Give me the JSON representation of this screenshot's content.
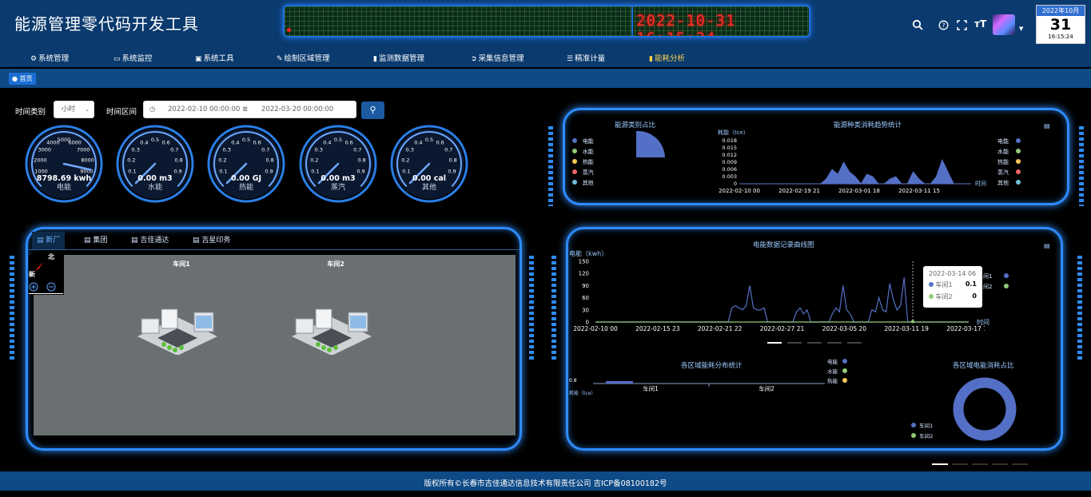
{
  "header": {
    "app_title": "能源管理零代码开发工具",
    "datetime": "2022-10-31 16:15:24",
    "calendar": {
      "month": "2022年10月",
      "day": "31",
      "time": "16:15:24"
    },
    "icons": [
      "search-icon",
      "help-icon",
      "fullscreen-icon",
      "font-size-icon",
      "avatar",
      "chevron-down-icon"
    ]
  },
  "menu": [
    {
      "label": "系统管理",
      "icon": "gear-icon"
    },
    {
      "label": "系统监控",
      "icon": "monitor-icon"
    },
    {
      "label": "系统工具",
      "icon": "toolbox-icon"
    },
    {
      "label": "绘制区域管理",
      "icon": "edit-icon"
    },
    {
      "label": "监测数据管理",
      "icon": "bar-chart-icon"
    },
    {
      "label": "采集信息管理",
      "icon": "send-icon"
    },
    {
      "label": "精准计量",
      "icon": "sliders-icon"
    },
    {
      "label": "能耗分析",
      "icon": "bar-chart-icon",
      "active": true,
      "active_color": "#ffd24a"
    }
  ],
  "breadcrumb": {
    "home": "首页"
  },
  "filters": {
    "time_type_label": "时间类别",
    "time_type_value": "小时",
    "time_range_label": "时间区间",
    "start": "2022-02-10 00:00:00",
    "end": "2022-03-20 00:00:00"
  },
  "gauges": [
    {
      "name": "电能",
      "value": "8798.69 kwh",
      "reading": 8798.69,
      "max": 10000,
      "ticks": [
        "1000",
        "2000",
        "3000",
        "4000",
        "5000",
        "6000",
        "7000",
        "8000",
        "9000"
      ],
      "unit_label": "kwh"
    },
    {
      "name": "水能",
      "value": "0.00 m3",
      "reading": 0,
      "max": 1,
      "ticks": [
        "0.1",
        "0.2",
        "0.3",
        "0.4",
        "0.5",
        "0.6",
        "0.7",
        "0.8",
        "0.9"
      ]
    },
    {
      "name": "热能",
      "value": "0.00 GJ",
      "reading": 0,
      "max": 1,
      "ticks": [
        "0.1",
        "0.2",
        "0.3",
        "0.4",
        "0.5",
        "0.6",
        "0.7",
        "0.8",
        "0.9"
      ]
    },
    {
      "name": "蒸汽",
      "value": "0.00 m3",
      "reading": 0,
      "max": 1,
      "ticks": [
        "0.1",
        "0.2",
        "0.3",
        "0.4",
        "0.5",
        "0.6",
        "0.7",
        "0.8",
        "0.9"
      ]
    },
    {
      "name": "其他",
      "value": "0.00 cal",
      "reading": 0,
      "max": 1,
      "ticks": [
        "0.1",
        "0.2",
        "0.3",
        "0.4",
        "0.5",
        "0.6",
        "0.7",
        "0.8",
        "0.9"
      ]
    }
  ],
  "energy_panel": {
    "pie_title": "能源类别占比",
    "trend_title": "能源种类消耗趋势统计",
    "y_label": "耗能（tce）",
    "x_label": "时间",
    "legend": [
      {
        "name": "电能",
        "color": "#5470c6"
      },
      {
        "name": "水能",
        "color": "#91cc75"
      },
      {
        "name": "热能",
        "color": "#fac858"
      },
      {
        "name": "蒸汽",
        "color": "#ee6666"
      },
      {
        "name": "其他",
        "color": "#73c0de"
      }
    ],
    "y_ticks": [
      "0",
      "0.003",
      "0.006",
      "0.009",
      "0.012",
      "0.015",
      "0.018"
    ],
    "x_ticks": [
      "2022-02-10 00",
      "2022-02-19 21",
      "2022-03-01 18",
      "2022-03-11 15"
    ]
  },
  "map_panel": {
    "tabs": [
      "新厂",
      "集团",
      "吉佳通达",
      "吉星印务"
    ],
    "north_label": "北",
    "side_label": "新",
    "workshops": [
      "车间1",
      "车间2"
    ]
  },
  "electric_panel": {
    "title": "电能数据记录曲线图",
    "y_label": "电能（kwh）",
    "x_label": "时间",
    "y_ticks": [
      "0",
      "30",
      "60",
      "90",
      "120",
      "150"
    ],
    "x_ticks": [
      "2022-02-10 00",
      "2022-02-15 23",
      "2022-02-21 22",
      "2022-02-27 21",
      "2022-03-05 20",
      "2022-03-11 19",
      "2022-03-17 18"
    ],
    "tooltip": {
      "time": "2022-03-14 06",
      "rows": [
        {
          "name": "车间1",
          "value": "0.1",
          "color": "#5470c6"
        },
        {
          "name": "车间2",
          "value": "0",
          "color": "#91cc75"
        }
      ]
    },
    "legend_partial": [
      "间1",
      "间2"
    ]
  },
  "region_panel": {
    "dist_title": "各区域能耗分布统计",
    "dist_y_label": "耗能（tce）",
    "dist_ticks": [
      "0.8",
      "0.6",
      "0.4",
      "0.2",
      "0"
    ],
    "dist_categories": [
      "车间1",
      "车间2"
    ],
    "dist_legend": [
      {
        "name": "电能",
        "color": "#5470c6"
      },
      {
        "name": "水能",
        "color": "#91cc75"
      },
      {
        "name": "热能",
        "color": "#fac858"
      }
    ],
    "share_title": "各区域电能消耗占比",
    "share_legend": [
      {
        "name": "车间1",
        "color": "#5470c6"
      },
      {
        "name": "车间2",
        "color": "#91cc75"
      }
    ]
  },
  "footer": {
    "text": "版权所有©长春市吉佳通达信息技术有限责任公司 吉ICP备08100182号"
  },
  "chart_data": [
    {
      "type": "pie",
      "title": "能源类别占比",
      "categories": [
        "电能",
        "水能",
        "热能",
        "蒸汽",
        "其他"
      ],
      "values": [
        100,
        0,
        0,
        0,
        0
      ]
    },
    {
      "type": "area",
      "title": "能源种类消耗趋势统计",
      "ylabel": "耗能（tce）",
      "xlabel": "时间",
      "ylim": [
        0,
        0.018
      ],
      "x_range": [
        "2022-02-10 00",
        "2022-03-20 00"
      ],
      "series": [
        {
          "name": "电能",
          "values": [
            0,
            0,
            0,
            0,
            0,
            0,
            0,
            0,
            0,
            0,
            0,
            0,
            0,
            0,
            0,
            0.002,
            0.006,
            0.004,
            0.009,
            0.005,
            0.003,
            0,
            0.004,
            0.003,
            0,
            0,
            0.002,
            0.003,
            0,
            0,
            0.005,
            0.002,
            0,
            0,
            0.003,
            0.01,
            0.005,
            0,
            0,
            0,
            0
          ]
        }
      ]
    },
    {
      "type": "line",
      "title": "电能数据记录曲线图",
      "ylabel": "电能（kwh）",
      "xlabel": "时间",
      "ylim": [
        0,
        150
      ],
      "x_range": [
        "2022-02-10 00",
        "2022-03-20 00"
      ],
      "series": [
        {
          "name": "车间1",
          "values": [
            0,
            0,
            0,
            0,
            0,
            0,
            0,
            0,
            0,
            0,
            0,
            0,
            0,
            0,
            0,
            0,
            0,
            0,
            0,
            0,
            0,
            0,
            0,
            0,
            0,
            0,
            0,
            0,
            0,
            0,
            0,
            0,
            0,
            0,
            0,
            0,
            0,
            0,
            35,
            40,
            35,
            30,
            40,
            90,
            35,
            30,
            30,
            35,
            0,
            0,
            0,
            0,
            0,
            0,
            0,
            0,
            25,
            35,
            20,
            30,
            0,
            0,
            0,
            0,
            0,
            0,
            20,
            35,
            25,
            90,
            30,
            20,
            0,
            0,
            0,
            0,
            0,
            30,
            25,
            60,
            30,
            25,
            95,
            55,
            30,
            40,
            110,
            0,
            0,
            0,
            0,
            0,
            0,
            0,
            0,
            0,
            0,
            0,
            0,
            0,
            0,
            0,
            0,
            0,
            0
          ]
        },
        {
          "name": "车间2",
          "values": [
            0,
            0,
            0,
            0,
            0,
            0,
            0,
            0,
            0,
            0,
            0,
            0,
            0,
            0,
            0,
            0,
            0,
            0,
            0,
            0,
            0,
            0,
            0,
            0,
            0,
            0,
            0,
            0,
            0,
            0,
            0,
            0,
            0,
            0,
            0,
            0,
            0,
            0,
            0,
            0,
            0,
            0,
            0,
            0,
            0,
            0,
            0,
            0,
            0,
            0,
            0,
            0,
            0,
            0,
            0,
            0,
            0,
            0,
            0,
            0,
            0,
            0,
            0,
            0,
            0,
            0,
            0,
            0,
            0,
            0,
            0,
            0,
            0,
            0,
            0,
            0,
            0,
            0,
            0,
            0,
            0,
            0,
            0,
            0,
            0,
            0,
            0,
            0,
            0,
            0,
            0,
            0,
            0,
            0,
            0,
            0,
            0,
            0,
            0,
            0,
            0,
            0,
            0,
            0,
            0
          ]
        }
      ]
    },
    {
      "type": "bar",
      "title": "各区域能耗分布统计",
      "ylabel": "耗能（tce）",
      "categories": [
        "车间1",
        "车间2"
      ],
      "series": [
        {
          "name": "电能",
          "values": [
            0.05,
            0
          ]
        },
        {
          "name": "水能",
          "values": [
            0,
            0
          ]
        },
        {
          "name": "热能",
          "values": [
            0,
            0
          ]
        }
      ]
    },
    {
      "type": "pie",
      "title": "各区域电能消耗占比",
      "categories": [
        "车间1",
        "车间2"
      ],
      "values": [
        100,
        0
      ]
    }
  ]
}
